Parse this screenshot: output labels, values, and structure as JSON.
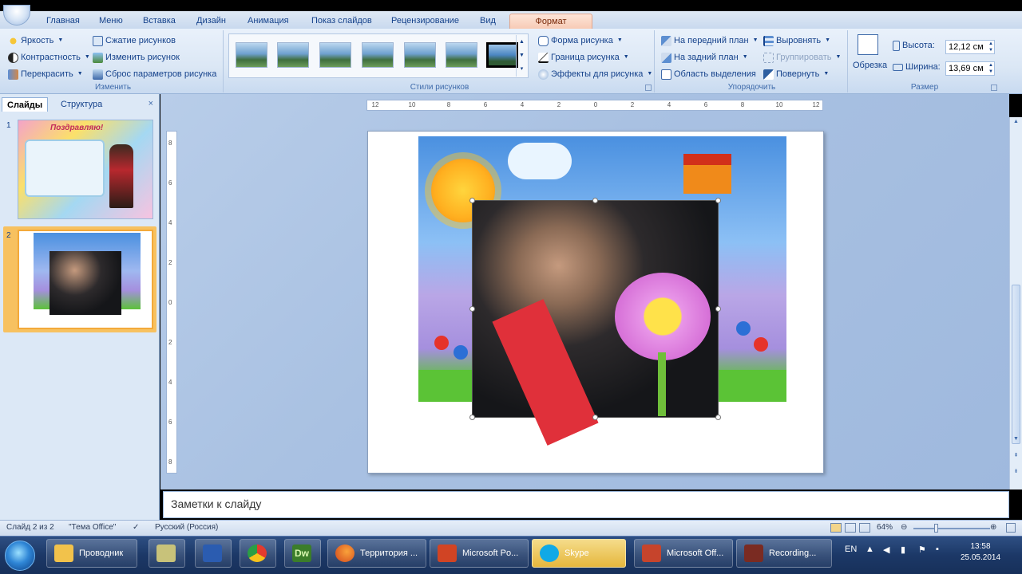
{
  "tabs": [
    "Главная",
    "Меню",
    "Вставка",
    "Дизайн",
    "Анимация",
    "Показ слайдов",
    "Рецензирование",
    "Вид",
    "Формат"
  ],
  "ribbon": {
    "adjust": {
      "brightness": "Яркость",
      "contrast": "Контрастность",
      "recolor": "Перекрасить",
      "compress": "Сжатие рисунков",
      "change": "Изменить рисунок",
      "reset": "Сброс параметров рисунка",
      "label": "Изменить"
    },
    "styles": {
      "shape": "Форма рисунка",
      "border": "Граница рисунка",
      "effects": "Эффекты для рисунка",
      "label": "Стили рисунков"
    },
    "arrange": {
      "front": "На передний план",
      "back": "На задний план",
      "selection": "Область выделения",
      "align": "Выровнять",
      "group": "Группировать",
      "rotate": "Повернуть",
      "label": "Упорядочить"
    },
    "size": {
      "crop": "Обрезка",
      "height_label": "Высота:",
      "height_value": "12,12 см",
      "width_label": "Ширина:",
      "width_value": "13,69 см",
      "label": "Размер"
    }
  },
  "slides_pane": {
    "tab_slides": "Слайды",
    "tab_outline": "Структура",
    "close": "×",
    "slides": [
      {
        "num": "1",
        "caption": "Поздравляю!"
      },
      {
        "num": "2"
      }
    ]
  },
  "ruler_h": [
    "12",
    "10",
    "8",
    "6",
    "4",
    "2",
    "0",
    "2",
    "4",
    "6",
    "8",
    "10",
    "12"
  ],
  "ruler_v": [
    "8",
    "6",
    "4",
    "2",
    "0",
    "2",
    "4",
    "6",
    "8"
  ],
  "notes": {
    "placeholder": "Заметки к слайду"
  },
  "status": {
    "slide": "Слайд 2 из 2",
    "theme": "\"Тема Office\"",
    "language": "Русский (Россия)",
    "zoom": "64%"
  },
  "taskbar": {
    "buttons": [
      {
        "label": "Проводник"
      },
      {
        "label": ""
      },
      {
        "label": ""
      },
      {
        "label": ""
      },
      {
        "label": "Dw"
      },
      {
        "label": "Территория ..."
      },
      {
        "label": "Microsoft Po..."
      },
      {
        "label": "Skype"
      },
      {
        "label": "Microsoft Off..."
      },
      {
        "label": "Recording..."
      }
    ],
    "lang": "EN",
    "time": "13:58",
    "date": "25.05.2014"
  }
}
